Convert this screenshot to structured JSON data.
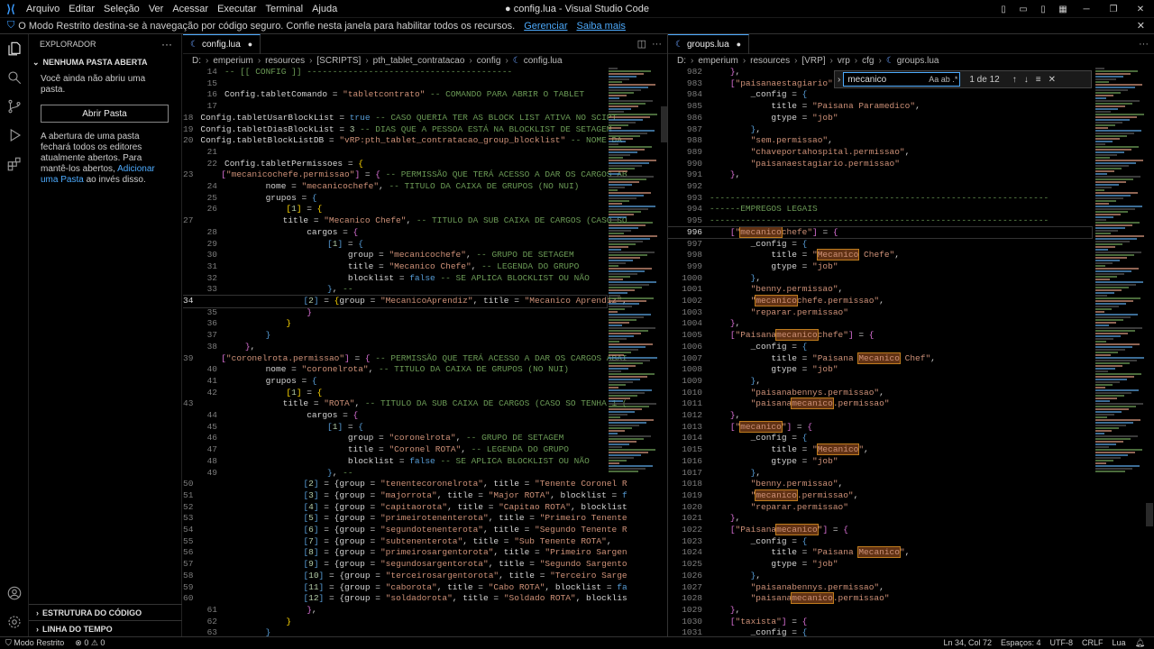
{
  "titlebar": {
    "menu": [
      "Arquivo",
      "Editar",
      "Seleção",
      "Ver",
      "Acessar",
      "Executar",
      "Terminal",
      "Ajuda"
    ],
    "title": "● config.lua - Visual Studio Code"
  },
  "banner": {
    "text": "O Modo Restrito destina-se à navegação por código seguro. Confie nesta janela para habilitar todos os recursos.",
    "manage": "Gerenciar",
    "learn": "Saiba mais"
  },
  "sidebar": {
    "title": "EXPLORADOR",
    "section": "NENHUMA PASTA ABERTA",
    "msg1": "Você ainda não abriu uma pasta.",
    "open_btn": "Abrir Pasta",
    "msg2": "A abertura de uma pasta fechará todos os editores atualmente abertos. Para mantê-los abertos,",
    "add_link": "Adicionar uma Pasta",
    "msg3": " ao invés disso.",
    "outline": "ESTRUTURA DO CÓDIGO",
    "timeline": "LINHA DO TEMPO"
  },
  "left_editor": {
    "tab": "config.lua",
    "crumbs": [
      "D:",
      "emperium",
      "resources",
      "[SCRIPTS]",
      "pth_tablet_contratacao",
      "config",
      "config.lua"
    ]
  },
  "right_editor": {
    "tab": "groups.lua",
    "crumbs": [
      "D:",
      "emperium",
      "resources",
      "[VRP]",
      "vrp",
      "cfg",
      "groups.lua"
    ],
    "find": {
      "query": "mecanico",
      "count": "1 de 12"
    }
  },
  "status": {
    "restricted": "Modo Restrito",
    "problems": "⊗ 0 ⚠ 0",
    "pos": "Ln 34, Col 72",
    "spaces": "Espaços: 4",
    "enc": "UTF-8",
    "eol": "CRLF",
    "lang": "Lua"
  }
}
